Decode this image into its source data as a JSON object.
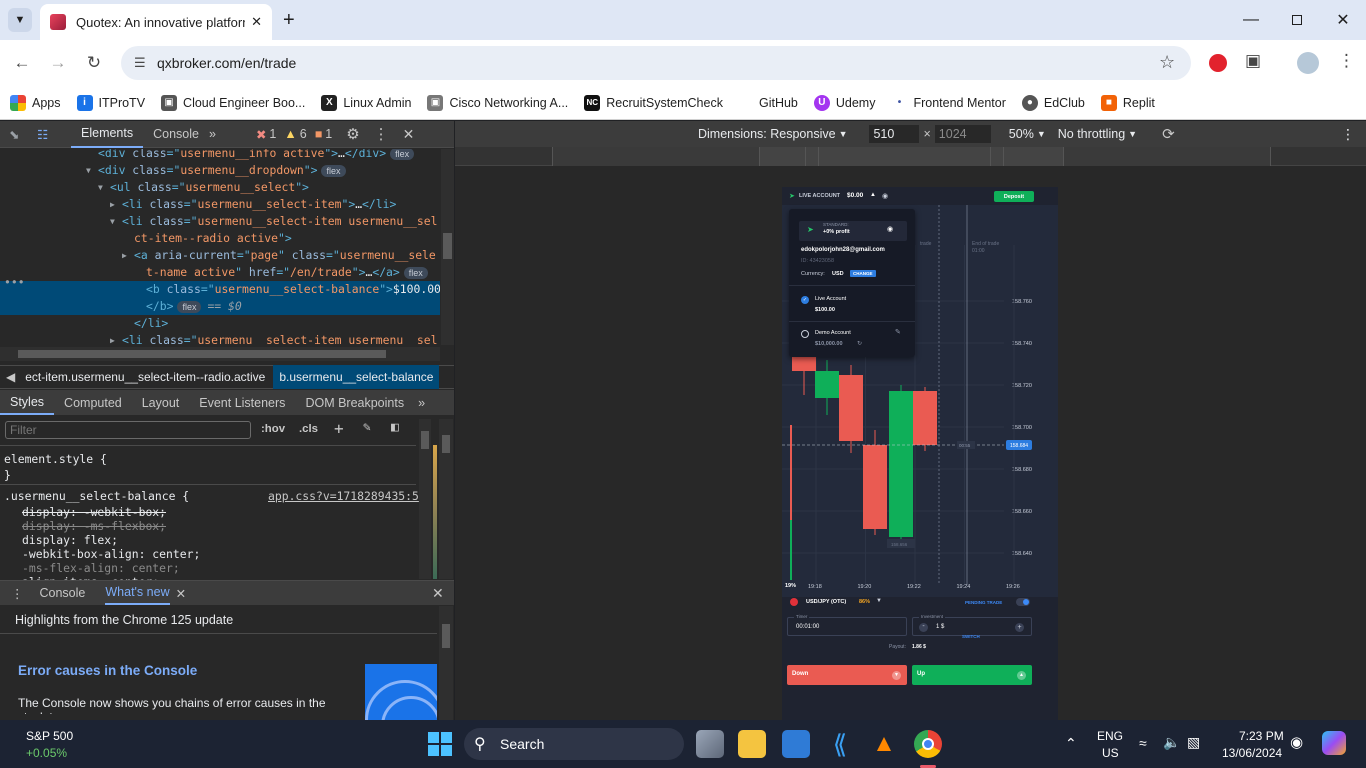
{
  "browser": {
    "tab_title": "Quotex: An innovative platform",
    "url": "qxbroker.com/en/trade",
    "bookmarks": [
      "Apps",
      "ITProTV",
      "Cloud Engineer Boo...",
      "Linux Admin",
      "Cisco Networking A...",
      "RecruitSystemCheck",
      "GitHub",
      "Udemy",
      "Frontend Mentor",
      "EdClub",
      "Replit"
    ]
  },
  "devtools": {
    "tabs": [
      "Elements",
      "Console"
    ],
    "errors": "1",
    "warnings": "6",
    "issues": "1",
    "dom_lines": [
      {
        "indent": 6,
        "parts": [
          [
            "tg",
            "<div "
          ],
          [
            "at",
            "class"
          ],
          [
            "tg",
            "=\""
          ],
          [
            "av",
            "usermenu__info active"
          ],
          [
            "tg",
            "\">"
          ],
          [
            "tx",
            "…"
          ],
          [
            "tg",
            "</div>"
          ]
        ],
        "badge": "flex"
      },
      {
        "indent": 6,
        "arrow": "▼",
        "parts": [
          [
            "tg",
            "<div "
          ],
          [
            "at",
            "class"
          ],
          [
            "tg",
            "=\""
          ],
          [
            "av",
            "usermenu__dropdown"
          ],
          [
            "tg",
            "\">"
          ]
        ],
        "badge": "flex"
      },
      {
        "indent": 7,
        "arrow": "▼",
        "parts": [
          [
            "tg",
            "<ul "
          ],
          [
            "at",
            "class"
          ],
          [
            "tg",
            "=\""
          ],
          [
            "av",
            "usermenu__select"
          ],
          [
            "tg",
            "\">"
          ]
        ]
      },
      {
        "indent": 8,
        "arrow": "▶",
        "parts": [
          [
            "tg",
            "<li "
          ],
          [
            "at",
            "class"
          ],
          [
            "tg",
            "=\""
          ],
          [
            "av",
            "usermenu__select-item"
          ],
          [
            "tg",
            "\">"
          ],
          [
            "tx",
            "…"
          ],
          [
            "tg",
            "</li>"
          ]
        ]
      },
      {
        "indent": 8,
        "arrow": "▼",
        "parts": [
          [
            "tg",
            "<li "
          ],
          [
            "at",
            "class"
          ],
          [
            "tg",
            "=\""
          ],
          [
            "av",
            "usermenu__select-item usermenu__sel"
          ]
        ]
      },
      {
        "indent": 9,
        "parts": [
          [
            "av",
            "ct-item--radio active"
          ],
          [
            "tg",
            "\">"
          ]
        ]
      },
      {
        "indent": 9,
        "arrow": "▶",
        "parts": [
          [
            "tg",
            "<a "
          ],
          [
            "at",
            "aria-current"
          ],
          [
            "tg",
            "=\""
          ],
          [
            "av",
            "page"
          ],
          [
            "tg",
            "\" "
          ],
          [
            "at",
            "class"
          ],
          [
            "tg",
            "=\""
          ],
          [
            "av",
            "usermenu__sele"
          ]
        ]
      },
      {
        "indent": 10,
        "parts": [
          [
            "av",
            "t-name active"
          ],
          [
            "tg",
            "\" "
          ],
          [
            "at",
            "href"
          ],
          [
            "tg",
            "=\""
          ],
          [
            "av",
            "/en/trade"
          ],
          [
            "tg",
            "\">"
          ],
          [
            "tx",
            "…"
          ],
          [
            "tg",
            "</a>"
          ]
        ],
        "badge": "flex"
      },
      {
        "indent": 10,
        "selected": true,
        "parts": [
          [
            "tg",
            "<b "
          ],
          [
            "at",
            "class"
          ],
          [
            "tg",
            "=\""
          ],
          [
            "av",
            "usermenu__select-balance"
          ],
          [
            "tg",
            "\">"
          ],
          [
            "tx",
            "$100.00"
          ]
        ]
      },
      {
        "indent": 10,
        "selected": true,
        "parts": [
          [
            "tg",
            "</b>"
          ]
        ],
        "badge": "flex",
        "suffix": "== $0"
      },
      {
        "indent": 9,
        "parts": [
          [
            "tg",
            "</li>"
          ]
        ]
      },
      {
        "indent": 8,
        "arrow": "▶",
        "parts": [
          [
            "tg",
            "<li "
          ],
          [
            "at",
            "class"
          ],
          [
            "tg",
            "=\""
          ],
          [
            "av",
            "usermenu__select-item usermenu__sel"
          ]
        ]
      }
    ],
    "breadcrumb": [
      "ect-item.usermenu__select-item--radio.active",
      "b.usermenu__select-balance"
    ],
    "style_tabs": [
      "Styles",
      "Computed",
      "Layout",
      "Event Listeners",
      "DOM Breakpoints"
    ],
    "filter_placeholder": "Filter",
    "hov": ":hov",
    "cls": ".cls",
    "element_style": "element.style {",
    "close_brace": "}",
    "rule_selector": ".usermenu__select-balance {",
    "rule_source": "app.css?v=1718289435:5",
    "declarations": [
      {
        "text": "display: -webkit-box;",
        "strike": true
      },
      {
        "text": "display: -ms-flexbox;",
        "strike": true,
        "dim": true
      },
      {
        "text": "display: flex;",
        "strike": false
      },
      {
        "text": "-webkit-box-align: center;",
        "strike": false
      },
      {
        "text": "-ms-flex-align: center;",
        "strike": false,
        "dim": true
      },
      {
        "text": "align-items: center;",
        "strike": false
      }
    ],
    "drawer_tabs": [
      "Console",
      "What's new"
    ],
    "drawer_headline": "Highlights from the Chrome 125 update",
    "drawer_title": "Error causes in the Console",
    "drawer_text": "The Console now shows you chains of error causes in the stack trace."
  },
  "viewport": {
    "dimensions": "Dimensions: Responsive",
    "width": "510",
    "height": "1024",
    "zoom": "50%",
    "throttle": "No throttling"
  },
  "app": {
    "account_label": "LIVE ACCOUNT",
    "balance": "$0.00",
    "deposit": "Deposit",
    "status": "STANDARD:",
    "profit": "+0% profit",
    "email": "edokpolorjohn28@gmail.com",
    "id": "ID: 43423058",
    "currency_label": "Currency:",
    "currency": "USD",
    "change": "CHANGE",
    "live_label": "Live Account",
    "live_balance": "$100.00",
    "demo_label": "Demo Account",
    "demo_balance": "$10,000.00",
    "trade_label": "trade",
    "end_label": "End of trade",
    "end_time": "01:00",
    "price_axis": [
      "158.760",
      "158.740",
      "158.720",
      "158.700",
      "158.680",
      "158.660",
      "158.640"
    ],
    "current_price": "158.684",
    "timer_tag": "00:55",
    "low_tag": "158.656",
    "time_axis": [
      "19:18",
      "19:20",
      "19:22",
      "19:24",
      "19:26"
    ],
    "percent": "19%",
    "asset": "USD/JPY (OTC)",
    "asset_payout": "86%",
    "pending": "PENDING TRADE",
    "timer_label": "Timer",
    "timer_value": "00:01:00",
    "investment_label": "Investment",
    "investment_value": "1 $",
    "switch": "SWITCH",
    "payout": "Payout:",
    "payout_value": "1.86 $",
    "down": "Down",
    "up": "Up"
  },
  "taskbar": {
    "ticker": "S&P 500",
    "ticker_change": "+0.05%",
    "search": "Search",
    "lang1": "ENG",
    "lang2": "US",
    "time": "7:23 PM",
    "date": "13/06/2024"
  }
}
